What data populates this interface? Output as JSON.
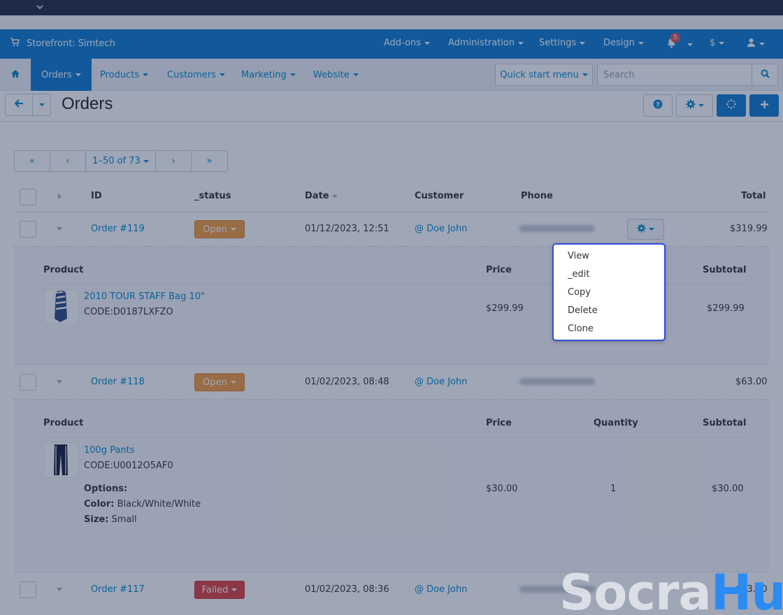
{
  "topbar": {
    "store_label": "Storefront: Simtech",
    "menus": [
      "Add-ons",
      "Administration",
      "Settings",
      "Design"
    ],
    "notification_count": "5",
    "currency": "$"
  },
  "nav": {
    "items": [
      "Orders",
      "Products",
      "Customers",
      "Marketing",
      "Website"
    ],
    "quick_start": "Quick start menu",
    "search_placeholder": "Search"
  },
  "page": {
    "title": "Orders"
  },
  "pager": {
    "first": "«",
    "prev": "‹",
    "range": "1–50 of 73",
    "next": "›",
    "last": "»"
  },
  "table": {
    "headers": {
      "id": "ID",
      "status": "_status",
      "date": "Date",
      "customer": "Customer",
      "phone": "Phone",
      "total": "Total"
    },
    "orders": [
      {
        "id": "Order #119",
        "status": "Open",
        "date": "01/12/2023, 12:51",
        "customer": "@ Doe John",
        "total": "$319.99"
      },
      {
        "id": "Order #118",
        "status": "Open",
        "date": "01/02/2023, 08:48",
        "customer": "@ Doe John",
        "total": "$63.00"
      },
      {
        "id": "Order #117",
        "status": "Failed",
        "date": "01/02/2023, 08:36",
        "customer": "@ Doe John",
        "total": "$63.00"
      }
    ]
  },
  "details": {
    "headers": {
      "product": "Product",
      "price": "Price",
      "quantity": "Quantity",
      "subtotal": "Subtotal"
    },
    "order119": {
      "name": "2010 TOUR STAFF Bag 10\"",
      "code": "CODE:D0187LXFZO",
      "price": "$299.99",
      "subtotal": "$299.99"
    },
    "order118": {
      "name": "100g Pants",
      "code": "CODE:U0012O5AF0",
      "options_label": "Options:",
      "color_label": "Color:",
      "color_value": "Black/White/White",
      "size_label": "Size:",
      "size_value": "Small",
      "price": "$30.00",
      "quantity": "1",
      "subtotal": "$30.00"
    }
  },
  "context_menu": {
    "items": [
      "View",
      "_edit",
      "Copy",
      "Delete",
      "Clone"
    ]
  },
  "watermark": {
    "part1": "Socra",
    "part2": "Hub"
  },
  "colors": {
    "accent": "#0b7bd0",
    "open": "#f39c3d",
    "failed": "#e0413f",
    "menu_border": "#2e4de0"
  }
}
